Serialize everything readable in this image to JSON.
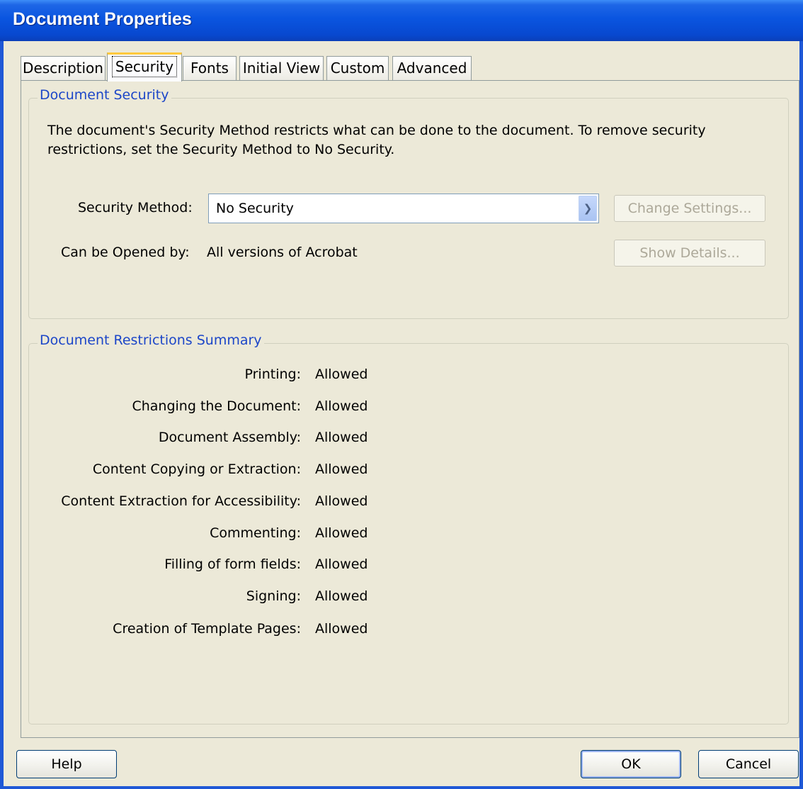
{
  "window": {
    "title": "Document Properties"
  },
  "tabs": [
    {
      "label": "Description"
    },
    {
      "label": "Security"
    },
    {
      "label": "Fonts"
    },
    {
      "label": "Initial View"
    },
    {
      "label": "Custom"
    },
    {
      "label": "Advanced"
    }
  ],
  "active_tab": "Security",
  "document_security": {
    "legend": "Document Security",
    "description_line1": "The document's Security Method restricts what can be done to the document. To remove security",
    "description_line2": "restrictions, set the Security Method to No Security.",
    "security_method_label": "Security Method:",
    "security_method_value": "No Security",
    "change_settings_label": "Change Settings...",
    "opened_by_label": "Can be Opened by:",
    "opened_by_value": "All versions of Acrobat",
    "show_details_label": "Show Details..."
  },
  "restrictions": {
    "legend": "Document Restrictions Summary",
    "rows": [
      {
        "label": "Printing:",
        "value": "Allowed"
      },
      {
        "label": "Changing the Document:",
        "value": "Allowed"
      },
      {
        "label": "Document Assembly:",
        "value": "Allowed"
      },
      {
        "label": "Content Copying or Extraction:",
        "value": "Allowed"
      },
      {
        "label": "Content Extraction for Accessibility:",
        "value": "Allowed"
      },
      {
        "label": "Commenting:",
        "value": "Allowed"
      },
      {
        "label": "Filling of form fields:",
        "value": "Allowed"
      },
      {
        "label": "Signing:",
        "value": "Allowed"
      },
      {
        "label": "Creation of Template Pages:",
        "value": "Allowed"
      }
    ]
  },
  "footer": {
    "help": "Help",
    "ok": "OK",
    "cancel": "Cancel"
  },
  "colors": {
    "titlebar": "#0a55e0",
    "legend": "#1c46c8",
    "dialog_bg": "#ece9d8"
  }
}
